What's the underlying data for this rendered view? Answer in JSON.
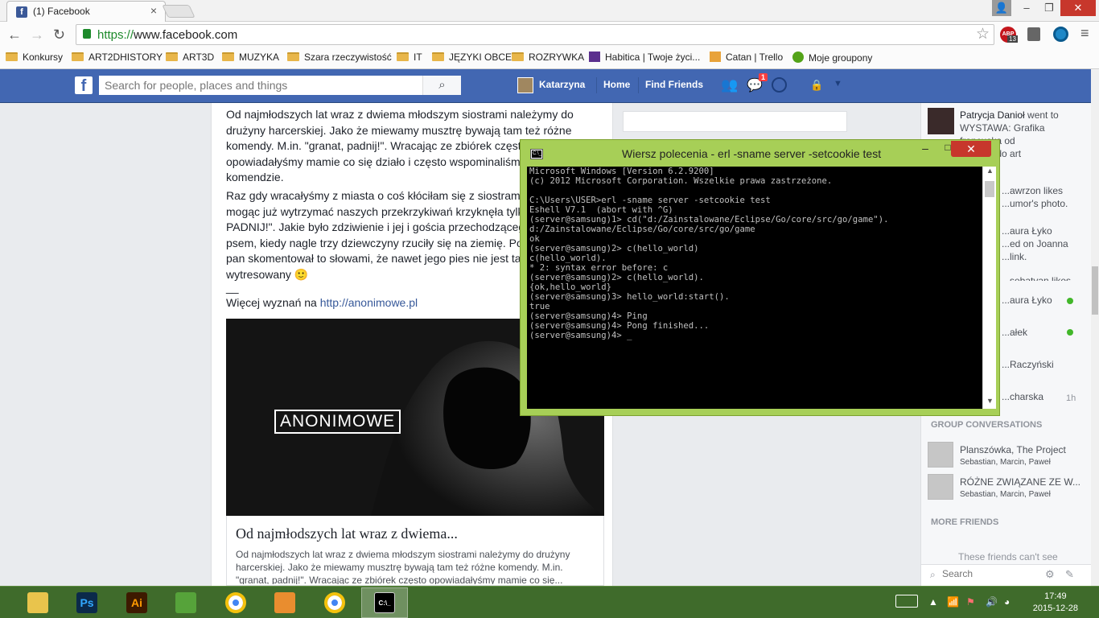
{
  "browser": {
    "tab_title": "(1) Facebook",
    "tab_favicon": "f",
    "url_scheme": "https://",
    "url_host": "www.facebook.com",
    "bookmarks": [
      {
        "label": "Konkursy",
        "icon": "folder-icon"
      },
      {
        "label": "ART2DHISTORY",
        "icon": "folder-icon"
      },
      {
        "label": "ART3D",
        "icon": "folder-icon"
      },
      {
        "label": "MUZYKA",
        "icon": "folder-icon"
      },
      {
        "label": "Szara rzeczywistość",
        "icon": "folder-icon"
      },
      {
        "label": "IT",
        "icon": "folder-icon"
      },
      {
        "label": "JĘZYKI OBCE",
        "icon": "folder-icon"
      },
      {
        "label": "ROZRYWKA",
        "icon": "folder-icon"
      },
      {
        "label": "Habitica | Twoje życi...",
        "icon": "habitica-icon"
      },
      {
        "label": "Catan | Trello",
        "icon": "trello-icon"
      },
      {
        "label": "Moje groupony",
        "icon": "groupon-icon"
      }
    ],
    "extension_abp_count": "13"
  },
  "facebook": {
    "logo": "f",
    "search_placeholder": "Search for people, places and things",
    "user_name": "Katarzyna",
    "nav_home": "Home",
    "nav_find_friends": "Find Friends",
    "messages_badge": "1"
  },
  "post": {
    "p1": "Od najmłodszych lat wraz z dwiema młodszym siostrami należymy do drużyny harcerskiej. Jako że miewamy musztrę bywają tam też różne komendy. M.in. \"granat, padnij!\". Wracając ze zbiórek często opowiadałyśmy mamie co się działo i często wspominaliśmy o tej komendzie.",
    "p2": "Raz gdy wracałyśmy z miasta o coś kłóciłam się z siostrami, mama nie mogąc już wytrzymać naszych przekrzykiwań krzyknęła tylko \"GRANAT PADNIJ!\". Jakie było zdziwienie i jej i gościa przechodzącego obok z psem, kiedy nagle trzy dziewczyny rzuciły się na ziemię. Po chwili ten pan skomentował to słowami, że nawet jego pies nie jest tak wytresowany 🙂",
    "separator": "__",
    "more_prefix": "Więcej wyznań na ",
    "more_link": "http://anonimowe.pl",
    "image_logo_text": "ANONIMOWE",
    "link_title": "Od najmłodszych lat wraz z dwiema...",
    "link_desc": "Od najmłodszych lat wraz z dwiema młodszym siostrami należymy do drużyny harcerskiej. Jako że miewamy musztrę bywają tam też różne komendy. M.in. \"granat, padnij!\". Wracając ze zbiórek często opowiadałyśmy mamie co się..."
  },
  "chat": {
    "ticker1_name": "Patrycja Danioł",
    "ticker1_text": " went to",
    "ticker1_line2": "WYSTAWA: Grafika",
    "ticker1_line3": "francuska od",
    "ticker1_line4": "...nizmu do art",
    "ticker2_line1": "...awrzon likes",
    "ticker2_line2": "...umor's photo.",
    "ticker3_line1": "...aura Łyko",
    "ticker3_line2": "...ed on Joanna",
    "ticker3_line3": "...link.",
    "ticker4_line1": "...sebatyan likes",
    "friends": [
      {
        "name": "...aura Łyko",
        "status": "online"
      },
      {
        "name": "...ałek",
        "status": "online"
      },
      {
        "name": "...Raczyński",
        "status": ""
      },
      {
        "name": "...charska",
        "status": "1h"
      }
    ],
    "group_header": "GROUP CONVERSATIONS",
    "groups": [
      {
        "name": "Planszówka, The Project",
        "members": "Sebastian, Marcin, Paweł"
      },
      {
        "name": "RÓŻNE ZWIĄZANE ZE W...",
        "members": "Sebastian, Marcin, Paweł"
      }
    ],
    "more_friends": "MORE FRIENDS",
    "cant_see": "These friends can't see",
    "search_placeholder": "Search"
  },
  "cmd": {
    "title": "Wiersz polecenia - erl  -sname server -setcookie test",
    "icon_text": "C:\\_",
    "lines": [
      "Microsoft Windows [Version 6.2.9200]",
      "(c) 2012 Microsoft Corporation. Wszelkie prawa zastrzeżone.",
      "",
      "C:\\Users\\USER>erl -sname server -setcookie test",
      "Eshell V7.1  (abort with ^G)",
      "(server@samsung)1> cd(\"d:/Zainstalowane/Eclipse/Go/core/src/go/game\").",
      "d:/Zainstalowane/Eclipse/Go/core/src/go/game",
      "ok",
      "(server@samsung)2> c(hello_world)",
      "c(hello_world).",
      "* 2: syntax error before: c",
      "(server@samsung)2> c(hello_world).",
      "{ok,hello_world}",
      "(server@samsung)3> hello_world:start().",
      "true",
      "(server@samsung)4> Ping",
      "(server@samsung)4> Pong finished...",
      "(server@samsung)4> _"
    ]
  },
  "taskbar": {
    "apps": [
      {
        "name": "file-explorer-icon",
        "label": "",
        "color": "#e9c44c"
      },
      {
        "name": "photoshop-icon",
        "label": "Ps",
        "color": "#0b2a4a"
      },
      {
        "name": "illustrator-icon",
        "label": "Ai",
        "color": "#3d1a00"
      },
      {
        "name": "maps-icon",
        "label": "",
        "color": "#56a33a"
      },
      {
        "name": "chrome-icon",
        "label": "",
        "color": "#db4437"
      },
      {
        "name": "video-player-icon",
        "label": "",
        "color": "#e98d2f"
      },
      {
        "name": "chrome-icon",
        "label": "",
        "color": "#db4437"
      },
      {
        "name": "cmd-icon",
        "label": "C:\\_",
        "color": "#000000"
      }
    ],
    "time": "17:49",
    "date": "2015-12-28"
  }
}
